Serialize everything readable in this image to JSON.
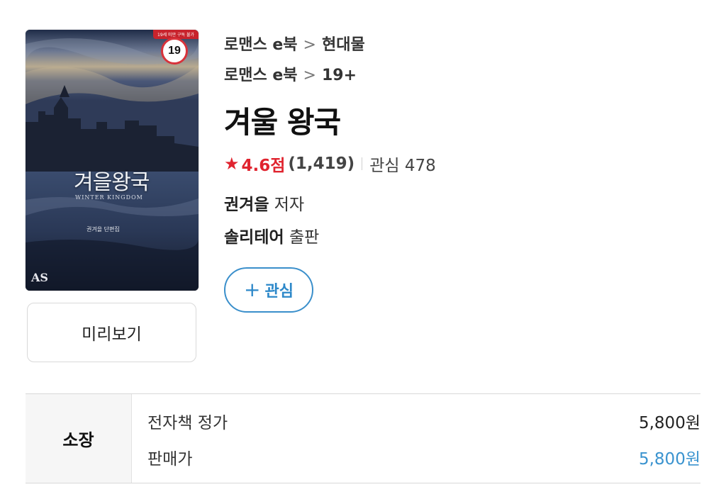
{
  "book": {
    "cover": {
      "title": "겨을왕국",
      "subtitle": "WINTER KINGDOM",
      "author": "권겨을 단편집",
      "banner": "19세 미만 구독 불가",
      "logo": "AS"
    },
    "age_badge": "19",
    "preview_label": "미리보기",
    "breadcrumbs": [
      {
        "parent": "로맨스 e북",
        "separator": ">",
        "child": "현대물"
      },
      {
        "parent": "로맨스 e북",
        "separator": ">",
        "child": "19+"
      }
    ],
    "title": "겨울 왕국",
    "rating": {
      "star": "★",
      "score": "4.6점",
      "count": "(1,419)",
      "wish_label": "관심 478"
    },
    "author": {
      "name": "권겨을",
      "suffix": " 저자"
    },
    "publisher": {
      "name": "솔리테어",
      "suffix": " 출판"
    },
    "wish_button": {
      "icon": "+",
      "label": "관심"
    }
  },
  "price": {
    "header": "소장",
    "rows": [
      {
        "label": "전자책 정가",
        "value": "5,800원"
      },
      {
        "label": "판매가",
        "value": "5,800원"
      }
    ]
  },
  "colors": {
    "accent_blue": "#2d88c9",
    "rating_red": "#e0242f",
    "badge_red": "#d8323a"
  }
}
